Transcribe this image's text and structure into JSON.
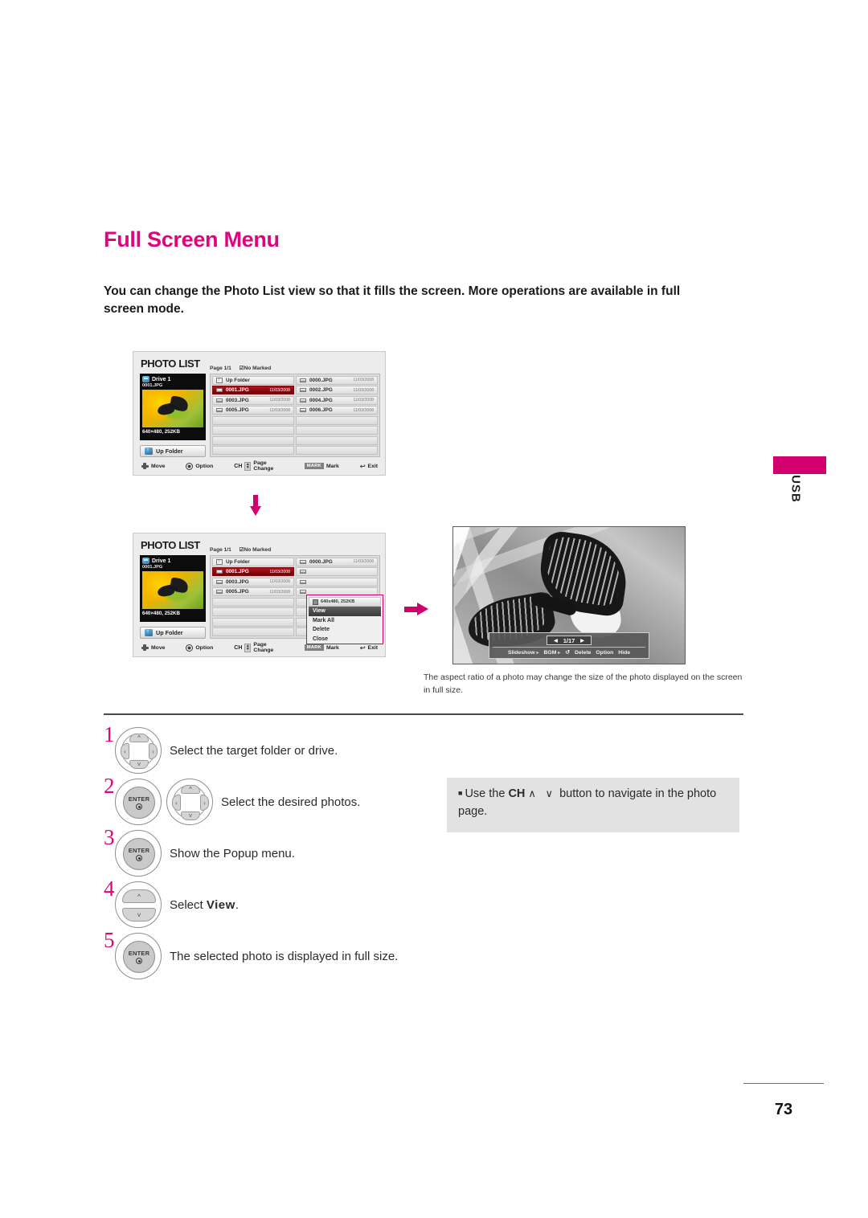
{
  "heading": "Full Screen Menu",
  "intro": "You can change the Photo List view so that it fills the screen. More operations are available in full screen mode.",
  "side_tab": {
    "label": "USB"
  },
  "tv_screen": {
    "title": "PHOTO LIST",
    "page_info": "Page 1/1",
    "marked_status": "No Marked",
    "drive": {
      "name": "Drive 1",
      "file": "0001.JPG",
      "dimensions": "640×480, 252KB",
      "up_folder_label": "Up Folder"
    },
    "file_list": {
      "up_folder_label": "Up Folder",
      "left_column": [
        {
          "name": "0001.JPG",
          "date": "11/03/2008",
          "selected": true
        },
        {
          "name": "0003.JPG",
          "date": "11/03/2008",
          "selected": false
        },
        {
          "name": "0005.JPG",
          "date": "11/03/2008",
          "selected": false
        }
      ],
      "right_column": [
        {
          "name": "0000.JPG",
          "date": "11/03/2008"
        },
        {
          "name": "0002.JPG",
          "date": "11/03/2008"
        },
        {
          "name": "0004.JPG",
          "date": "11/03/2008"
        },
        {
          "name": "0006.JPG",
          "date": "11/03/2008"
        }
      ]
    },
    "hints": {
      "move": "Move",
      "option": "Option",
      "ch": "CH",
      "page_change": "Page Change",
      "mark_key": "MARK",
      "mark": "Mark",
      "exit": "Exit"
    }
  },
  "popup_menu": {
    "header": "640x480, 252KB",
    "items": [
      {
        "label": "View",
        "active": true
      },
      {
        "label": "Mark All",
        "active": false
      },
      {
        "label": "Delete",
        "active": false
      },
      {
        "label": "Close",
        "active": false
      }
    ]
  },
  "photo_view": {
    "counter": "1/17",
    "toolbar": [
      {
        "label": "Slideshow",
        "arrow": "▸"
      },
      {
        "label": "BGM",
        "arrow": "▸"
      },
      {
        "label": "↺",
        "arrow": ""
      },
      {
        "label": "Delete",
        "arrow": ""
      },
      {
        "label": "Option",
        "arrow": ""
      },
      {
        "label": "Hide",
        "arrow": ""
      }
    ],
    "caption": "The aspect ratio of a photo may change the size of the photo displayed on the screen in full size."
  },
  "steps": [
    {
      "num": "1",
      "text": "Select the target folder or drive."
    },
    {
      "num": "2",
      "text": "Select the desired photos."
    },
    {
      "num": "3",
      "text": "Show the Popup menu."
    },
    {
      "num": "4",
      "text_pre": "Select ",
      "text_bold": "View",
      "text_post": "."
    },
    {
      "num": "5",
      "text": "The selected photo is displayed in full size."
    }
  ],
  "note": {
    "pre": "Use the ",
    "key": "CH",
    "chevrons": "∧ ∨",
    "post": " button to navigate in the photo page."
  },
  "footer": {
    "page_number": "73"
  },
  "colors": {
    "accent": "#e0047e",
    "tab": "#d2006e",
    "selected_row": "#8a0a10",
    "note_bg": "#e2e2e2"
  }
}
